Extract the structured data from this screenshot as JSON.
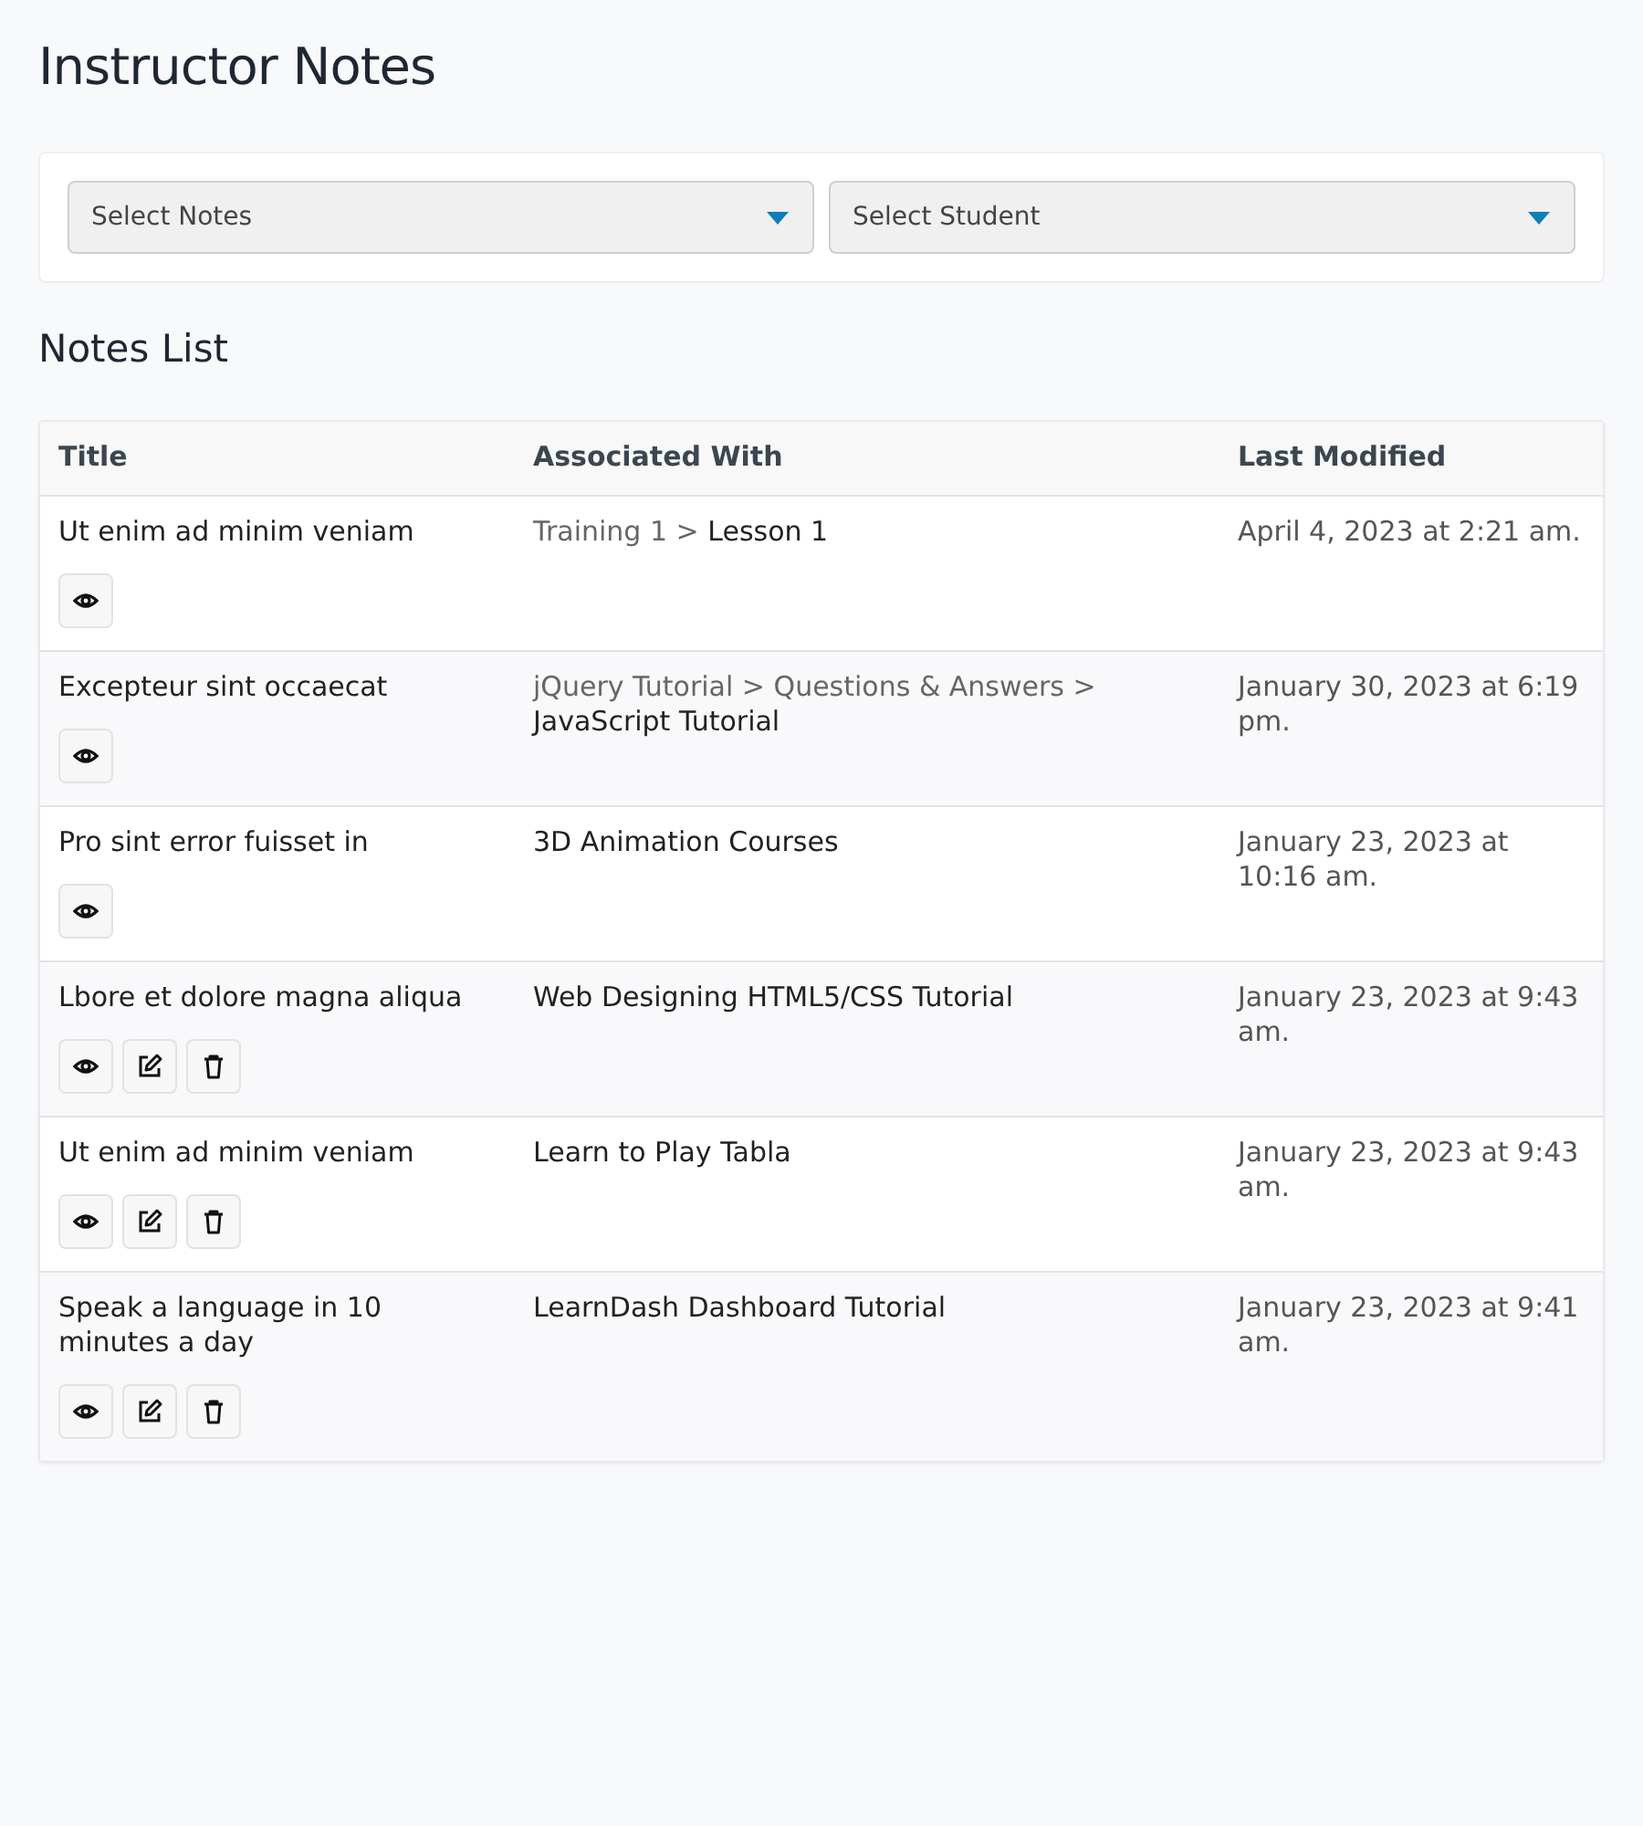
{
  "page_title": "Instructor Notes",
  "filters": [
    {
      "placeholder": "Select Notes"
    },
    {
      "placeholder": "Select Student"
    }
  ],
  "section_title": "Notes List",
  "table": {
    "columns": [
      "Title",
      "Associated With",
      "Last Modified"
    ],
    "rows": [
      {
        "title": "Ut enim ad minim veniam",
        "parents": "Training 1 >",
        "current": "Lesson 1",
        "modified": "April 4, 2023 at 2:21 am.",
        "actions": [
          {
            "kind": "view"
          }
        ]
      },
      {
        "title": "Excepteur sint occaecat",
        "parents": "jQuery Tutorial > Questions & Answers >",
        "current": "JavaScript Tutorial",
        "modified": "January 30, 2023 at 6:19 pm.",
        "actions": [
          {
            "kind": "view"
          }
        ]
      },
      {
        "title": "Pro sint error fuisset in",
        "current": "3D Animation Courses",
        "modified": "January 23, 2023 at 10:16 am.",
        "actions": [
          {
            "kind": "view"
          }
        ]
      },
      {
        "title": "Lbore et dolore magna aliqua",
        "current": "Web Designing HTML5/CSS Tutorial",
        "modified": "January 23, 2023 at 9:43 am.",
        "actions": [
          {
            "kind": "view"
          },
          {
            "kind": "edit"
          },
          {
            "kind": "delete"
          }
        ]
      },
      {
        "title": "Ut enim ad minim veniam",
        "current": "Learn to Play Tabla",
        "modified": "January 23, 2023 at 9:43 am.",
        "actions": [
          {
            "kind": "view"
          },
          {
            "kind": "edit"
          },
          {
            "kind": "delete"
          }
        ]
      },
      {
        "title": "Speak a language in 10 minutes a day",
        "current": "LearnDash Dashboard Tutorial",
        "modified": "January 23, 2023 at 9:41 am.",
        "actions": [
          {
            "kind": "view"
          },
          {
            "kind": "edit"
          },
          {
            "kind": "delete"
          }
        ]
      }
    ]
  }
}
